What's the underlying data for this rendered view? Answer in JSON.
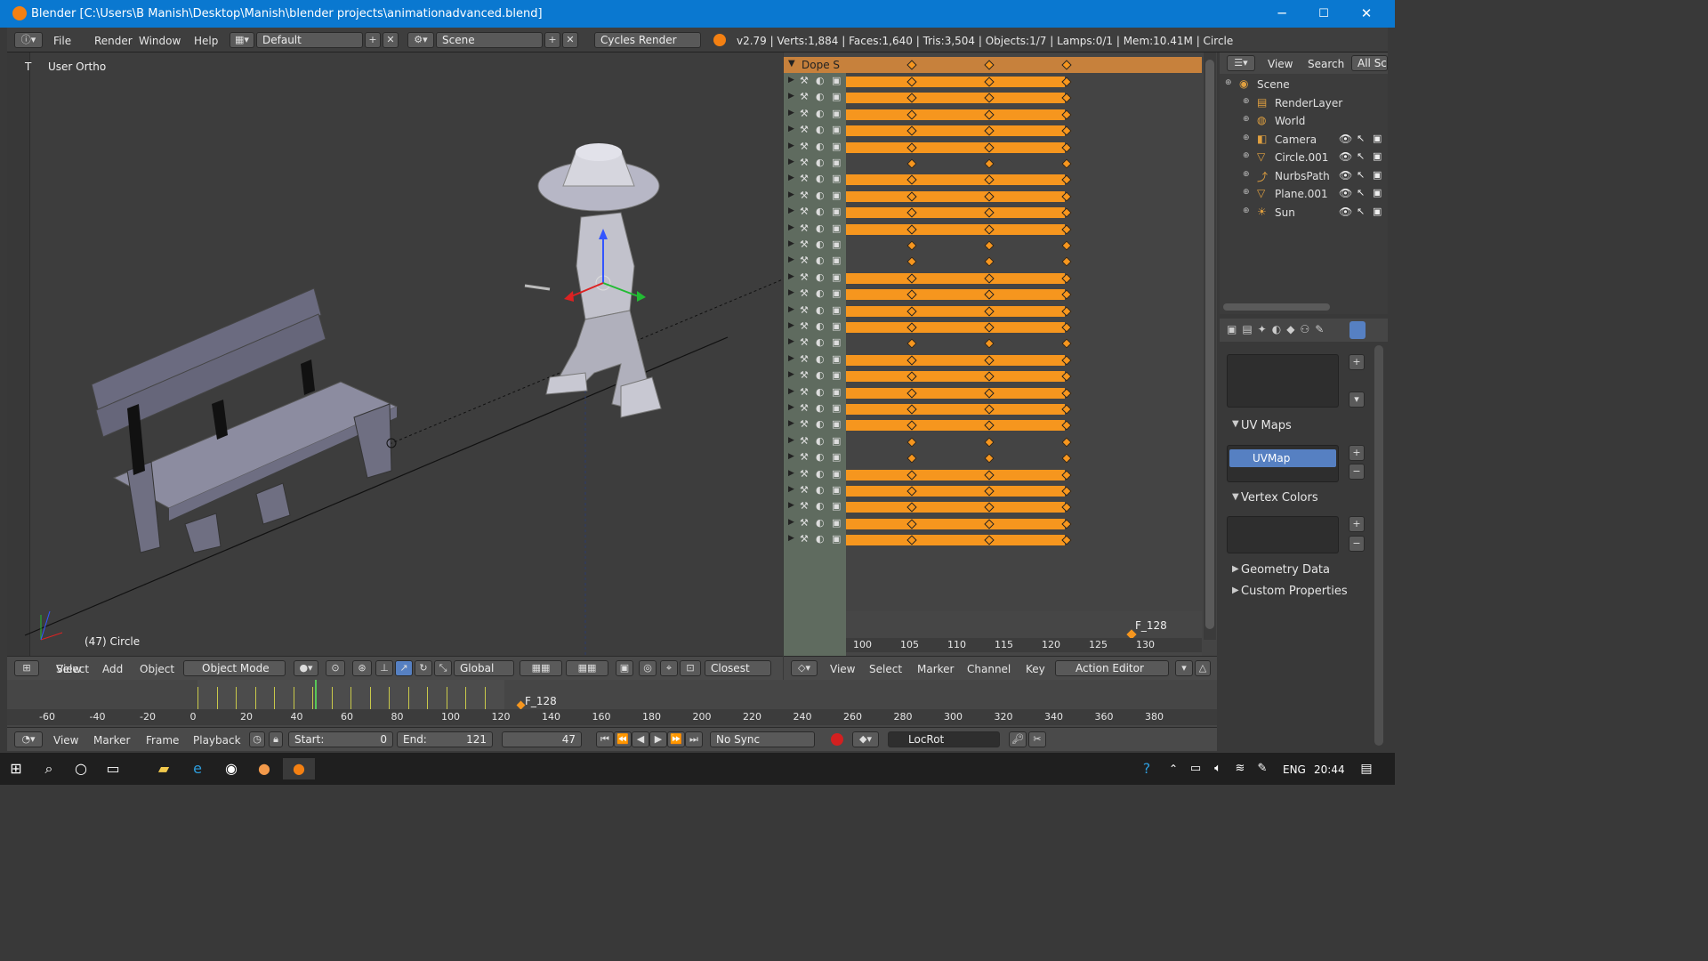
{
  "window": {
    "title": "Blender [C:\\Users\\B Manish\\Desktop\\Manish\\blender projects\\animationadvanced.blend]",
    "minimize": "─",
    "maximize": "☐",
    "close": "✕"
  },
  "topbar": {
    "menus": [
      "File",
      "Render",
      "Window",
      "Help"
    ],
    "layout": "Default",
    "scene": "Scene",
    "engine": "Cycles Render",
    "stats": "v2.79 | Verts:1,884 | Faces:1,640 | Tris:3,504 | Objects:1/7 | Lamps:0/1 | Mem:10.41M | Circle"
  },
  "viewport": {
    "view_label": "User Ortho",
    "object_label": "(47) Circle",
    "header": {
      "view": "View",
      "select": "Select",
      "add": "Add",
      "object": "Object",
      "mode": "Object Mode",
      "orientation": "Global",
      "snap": "Closest"
    }
  },
  "dopesheet": {
    "summary_label": "Dope S",
    "ruler": [
      "100",
      "105",
      "110",
      "115",
      "120",
      "125",
      "130"
    ],
    "marker": "F_128",
    "header": {
      "view": "View",
      "select": "Select",
      "marker": "Marker",
      "channel": "Channel",
      "key": "Key",
      "mode": "Action Editor"
    }
  },
  "outliner": {
    "header": {
      "view": "View",
      "search": "Search",
      "filter": "All Sce"
    },
    "items": [
      {
        "label": "Scene",
        "level": 0
      },
      {
        "label": "RenderLayer",
        "level": 1
      },
      {
        "label": "World",
        "level": 1
      },
      {
        "label": "Camera",
        "level": 1
      },
      {
        "label": "Circle.001",
        "level": 1
      },
      {
        "label": "NurbsPath",
        "level": 1
      },
      {
        "label": "Plane.001",
        "level": 1
      },
      {
        "label": "Sun",
        "level": 1
      }
    ]
  },
  "properties": {
    "uv_maps": "UV Maps",
    "uv_item": "UVMap",
    "vertex_colors": "Vertex Colors",
    "geometry_data": "Geometry Data",
    "custom_properties": "Custom Properties"
  },
  "timeline": {
    "ruler": [
      "-60",
      "-40",
      "-20",
      "0",
      "20",
      "40",
      "60",
      "80",
      "100",
      "120",
      "140",
      "160",
      "180",
      "200",
      "220",
      "240",
      "260",
      "280",
      "300",
      "320",
      "340",
      "360",
      "380"
    ],
    "marker": "F_128",
    "footer": {
      "view": "View",
      "marker": "Marker",
      "frame": "Frame",
      "playback": "Playback",
      "start_label": "Start:",
      "start": "0",
      "end_label": "End:",
      "end": "121",
      "current": "47",
      "sync": "No Sync",
      "keying_set": "LocRot"
    }
  },
  "taskbar": {
    "lang": "ENG",
    "time": "20:44"
  },
  "colors": {
    "key_orange": "#f6961e",
    "selected_blue": "#5680c2",
    "title_blue": "#0a78d0"
  }
}
